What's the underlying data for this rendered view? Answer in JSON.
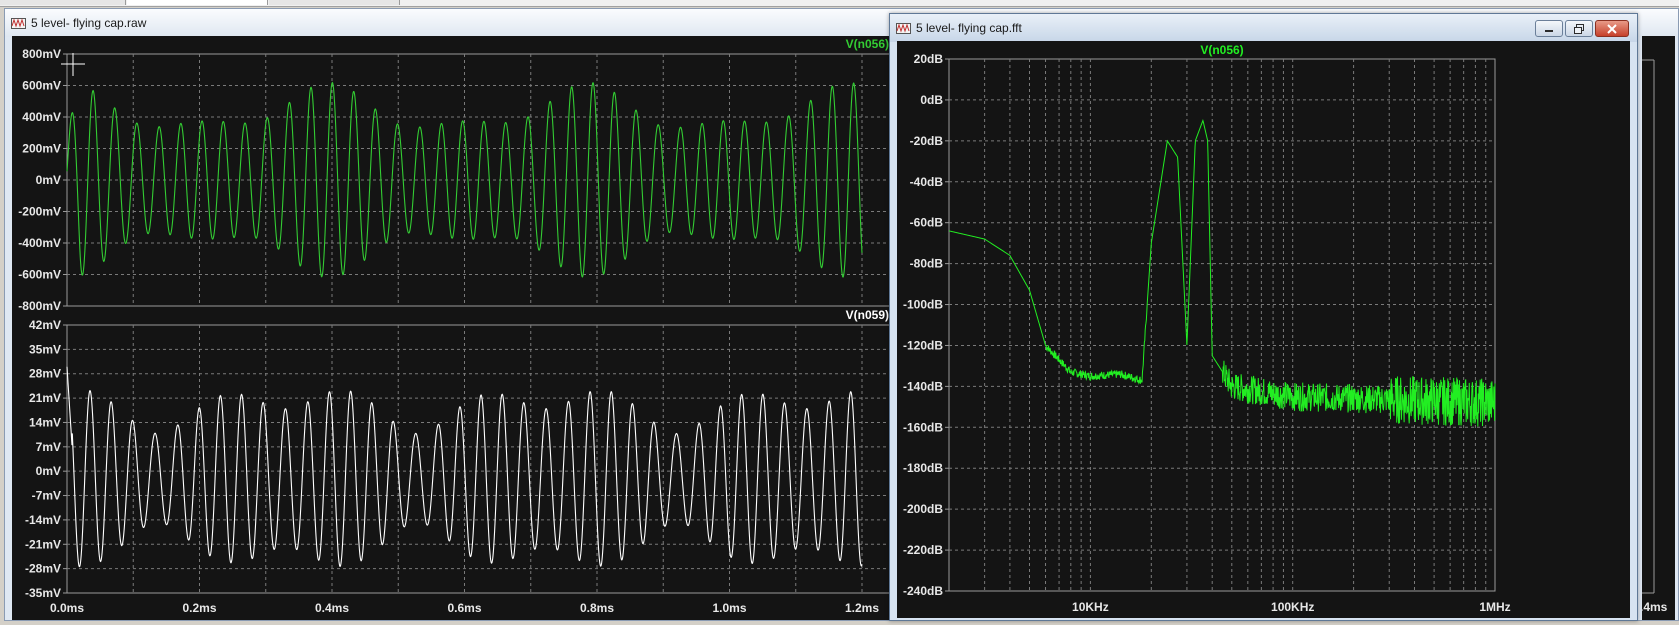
{
  "raw_window": {
    "title": "5 level- flying cap.raw",
    "top_pane": {
      "trace_label": "V(n056)",
      "y_ticks": [
        "800mV",
        "600mV",
        "400mV",
        "200mV",
        "0mV",
        "-200mV",
        "-400mV",
        "-600mV",
        "-800mV"
      ]
    },
    "bottom_pane": {
      "trace_label": "V(n059)",
      "y_ticks": [
        "42mV",
        "35mV",
        "28mV",
        "21mV",
        "14mV",
        "7mV",
        "0mV",
        "-7mV",
        "-14mV",
        "-21mV",
        "-28mV",
        "-35mV"
      ]
    },
    "x_ticks": [
      "0.0ms",
      "0.2ms",
      "0.4ms",
      "0.6ms",
      "0.8ms",
      "1.0ms",
      "1.2ms"
    ],
    "x_tick_partial": ".4ms"
  },
  "fft_window": {
    "title": "5 level- flying cap.fft",
    "trace_label": "V(n056)",
    "y_ticks": [
      "20dB",
      "0dB",
      "-20dB",
      "-40dB",
      "-60dB",
      "-80dB",
      "-100dB",
      "-120dB",
      "-140dB",
      "-160dB",
      "-180dB",
      "-200dB",
      "-220dB",
      "-240dB"
    ],
    "x_ticks": [
      "10KHz",
      "100KHz",
      "1MHz"
    ]
  },
  "chart_data": [
    {
      "type": "line",
      "series": [
        {
          "name": "V(n056)",
          "color": "#33cc33"
        }
      ],
      "x_unit": "ms",
      "xlim": [
        0,
        1.2
      ],
      "y_unit": "mV",
      "ylim": [
        -800,
        800
      ],
      "grid": true
    },
    {
      "type": "line",
      "series": [
        {
          "name": "V(n059)",
          "color": "#ffffff"
        }
      ],
      "x_unit": "ms",
      "xlim": [
        0,
        1.2
      ],
      "y_unit": "mV",
      "ylim": [
        -35,
        42
      ],
      "grid": true
    },
    {
      "type": "line",
      "series": [
        {
          "name": "V(n056)",
          "color": "#22ee22"
        }
      ],
      "x_scale": "log",
      "x_unit": "Hz",
      "xlim": [
        2000,
        1000000
      ],
      "y_unit": "dB",
      "ylim": [
        -240,
        20
      ],
      "grid": true,
      "key_points": [
        [
          2000,
          -64
        ],
        [
          3000,
          -68
        ],
        [
          4000,
          -76
        ],
        [
          5000,
          -93
        ],
        [
          6000,
          -120
        ],
        [
          8000,
          -133
        ],
        [
          10000,
          -135
        ],
        [
          14000,
          -134
        ],
        [
          18000,
          -137
        ],
        [
          20000,
          -70
        ],
        [
          24000,
          -20
        ],
        [
          27000,
          -28
        ],
        [
          30000,
          -120
        ],
        [
          33000,
          -20
        ],
        [
          36000,
          -10
        ],
        [
          38000,
          -20
        ],
        [
          40000,
          -125
        ],
        [
          50000,
          -140
        ],
        [
          100000,
          -145
        ],
        [
          1000000,
          -148
        ]
      ]
    }
  ]
}
